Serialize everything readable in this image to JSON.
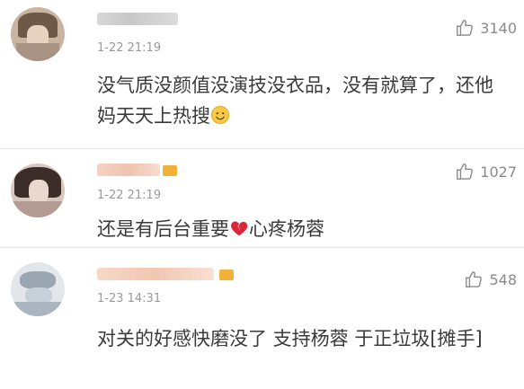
{
  "comments": [
    {
      "timestamp": "1-22 21:19",
      "likes": "3140",
      "text": "没气质没颜值没演技没衣品，没有就算了，还他妈天天上热搜",
      "emoji": "smiley-emoji"
    },
    {
      "timestamp": "1-22 21:19",
      "likes": "1027",
      "text_before": "还是有后台重要",
      "text_after": "心疼杨蓉",
      "emoji": "broken-heart-emoji"
    },
    {
      "timestamp": "1-23 14:31",
      "likes": "548",
      "text": "对关的好感快磨没了 支持杨蓉 于正垃圾[摊手]"
    }
  ],
  "icons": {
    "like": "thumbs-up-icon"
  },
  "colors": {
    "text": "#3a3a3a",
    "meta": "#999999",
    "like": "#8a8a8a",
    "divider": "#e6e6e6",
    "vip_badge": "#f2b23a"
  }
}
